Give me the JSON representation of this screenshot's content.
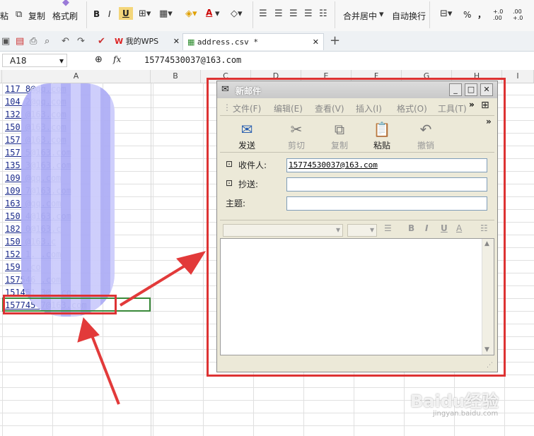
{
  "ribbon": {
    "paste_label": "粘",
    "copy_label": "复制",
    "format_painter_label": "格式刷",
    "bold": "B",
    "italic": "I",
    "underline": "U",
    "font_color": "A",
    "merge_center_label": "合并居中",
    "wrap_text_label": "自动换行",
    "percent": "%",
    "comma": "，",
    "dec_inc": "+.0 .00",
    "dec_dec": ".00 +.0"
  },
  "tabs": {
    "wps_tab": "我的WPS",
    "file_tab": "address.csv *"
  },
  "formula_bar": {
    "name_box": "A18",
    "fx": "fx",
    "value": "15774530037@163.com"
  },
  "columns": [
    "A",
    "B",
    "C",
    "D",
    "E",
    "F",
    "G",
    "H",
    "I"
  ],
  "cells": [
    "117",
    "104",
    "132",
    "150",
    "157",
    "157",
    "135",
    "109",
    "109",
    "163",
    "150",
    "182",
    "150",
    "152",
    "159",
    "157546",
    "151451",
    "15774530037@163.com"
  ],
  "cells_visible": [
    "117 8@qq.com",
    "104 2@qq.com",
    "132 @163.com",
    "150 @163.com",
    "157 @163.com",
    "157 5@163.com",
    "135 3@163.com",
    "109 @qq.com",
    "109 7@163.com",
    "163 @qq.com",
    "150 4@163.com",
    "182 0@163.c",
    "150 @163.c",
    "152 1. .com",
    "159 .co",
    "157546 .com",
    "151451 3@ .com",
    "157745 7@163.com"
  ],
  "dialog": {
    "title": "新邮件",
    "menu": [
      "文件(F)",
      "编辑(E)",
      "查看(V)",
      "插入(I)",
      "格式(O)",
      "工具(T)"
    ],
    "tools": [
      {
        "label": "发送",
        "icon": "send-icon",
        "enabled": true
      },
      {
        "label": "剪切",
        "icon": "scissors-icon",
        "enabled": false
      },
      {
        "label": "复制",
        "icon": "copy-icon",
        "enabled": false
      },
      {
        "label": "粘贴",
        "icon": "clipboard-icon",
        "enabled": true
      },
      {
        "label": "撤销",
        "icon": "undo-icon",
        "enabled": false
      }
    ],
    "to_label": "收件人:",
    "cc_label": "抄送:",
    "subject_label": "主题:",
    "to_value": "15774530037@163.com",
    "cc_value": "",
    "subject_value": ""
  },
  "watermark": {
    "brand": "Baidu经验",
    "url": "jingyan.baidu.com"
  },
  "colors": {
    "annotation_red": "#dd3333",
    "selection_green": "#3a8a3a",
    "link_blue": "#1a2a8a"
  }
}
